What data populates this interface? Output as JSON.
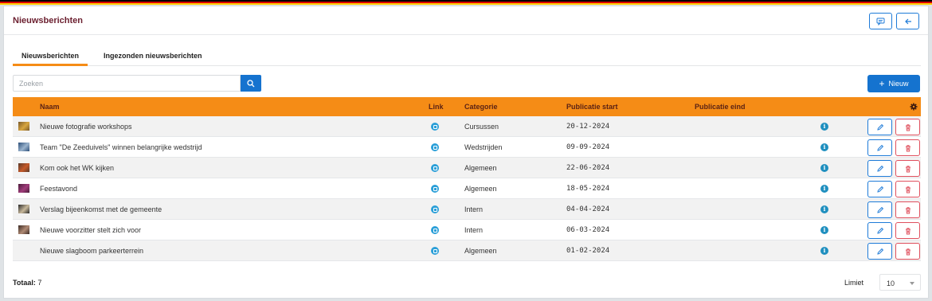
{
  "header": {
    "title": "Nieuwsberichten",
    "flag_colors": [
      "#000000",
      "#dd0000",
      "#ffce00"
    ]
  },
  "tabs": [
    {
      "label": "Nieuwsberichten",
      "active": true
    },
    {
      "label": "Ingezonden nieuwsberichten",
      "active": false
    }
  ],
  "search": {
    "placeholder": "Zoeken"
  },
  "new_button": {
    "label": "Nieuw"
  },
  "table": {
    "columns": {
      "name": "Naam",
      "link": "Link",
      "category": "Categorie",
      "pub_start": "Publicatie start",
      "pub_end": "Publicatie eind"
    },
    "rows": [
      {
        "name": "Nieuwe fotografie workshops",
        "category": "Cursussen",
        "pub_start": "20-12-2024",
        "pub_end": "",
        "thumb": [
          "#7a5a2a",
          "#d8a640"
        ]
      },
      {
        "name": "Team \"De Zeeduivels\" winnen belangrijke wedstrijd",
        "category": "Wedstrijden",
        "pub_start": "09-09-2024",
        "pub_end": "",
        "thumb": [
          "#2c4f7a",
          "#9ab3cc"
        ]
      },
      {
        "name": "Kom ook het WK kijken",
        "category": "Algemeen",
        "pub_start": "22-06-2024",
        "pub_end": "",
        "thumb": [
          "#5a3a2a",
          "#c65a2a"
        ]
      },
      {
        "name": "Feestavond",
        "category": "Algemeen",
        "pub_start": "18-05-2024",
        "pub_end": "",
        "thumb": [
          "#4a1c3a",
          "#a03c7a"
        ]
      },
      {
        "name": "Verslag bijeenkomst met de gemeente",
        "category": "Intern",
        "pub_start": "04-04-2024",
        "pub_end": "",
        "thumb": [
          "#2a2a2a",
          "#c8b89a"
        ]
      },
      {
        "name": "Nieuwe voorzitter stelt zich voor",
        "category": "Intern",
        "pub_start": "06-03-2024",
        "pub_end": "",
        "thumb": [
          "#3a2a24",
          "#b08a74"
        ]
      },
      {
        "name": "Nieuwe slagboom parkeerterrein",
        "category": "Algemeen",
        "pub_start": "01-02-2024",
        "pub_end": "",
        "thumb": null
      }
    ]
  },
  "footer": {
    "total_label": "Totaal:",
    "total_value": "7",
    "limit_label": "Limiet",
    "limit_value": "10"
  },
  "colors": {
    "accent": "#f58c16",
    "primary": "#1573cf",
    "danger": "#e0505e",
    "title": "#6b1f2f"
  }
}
